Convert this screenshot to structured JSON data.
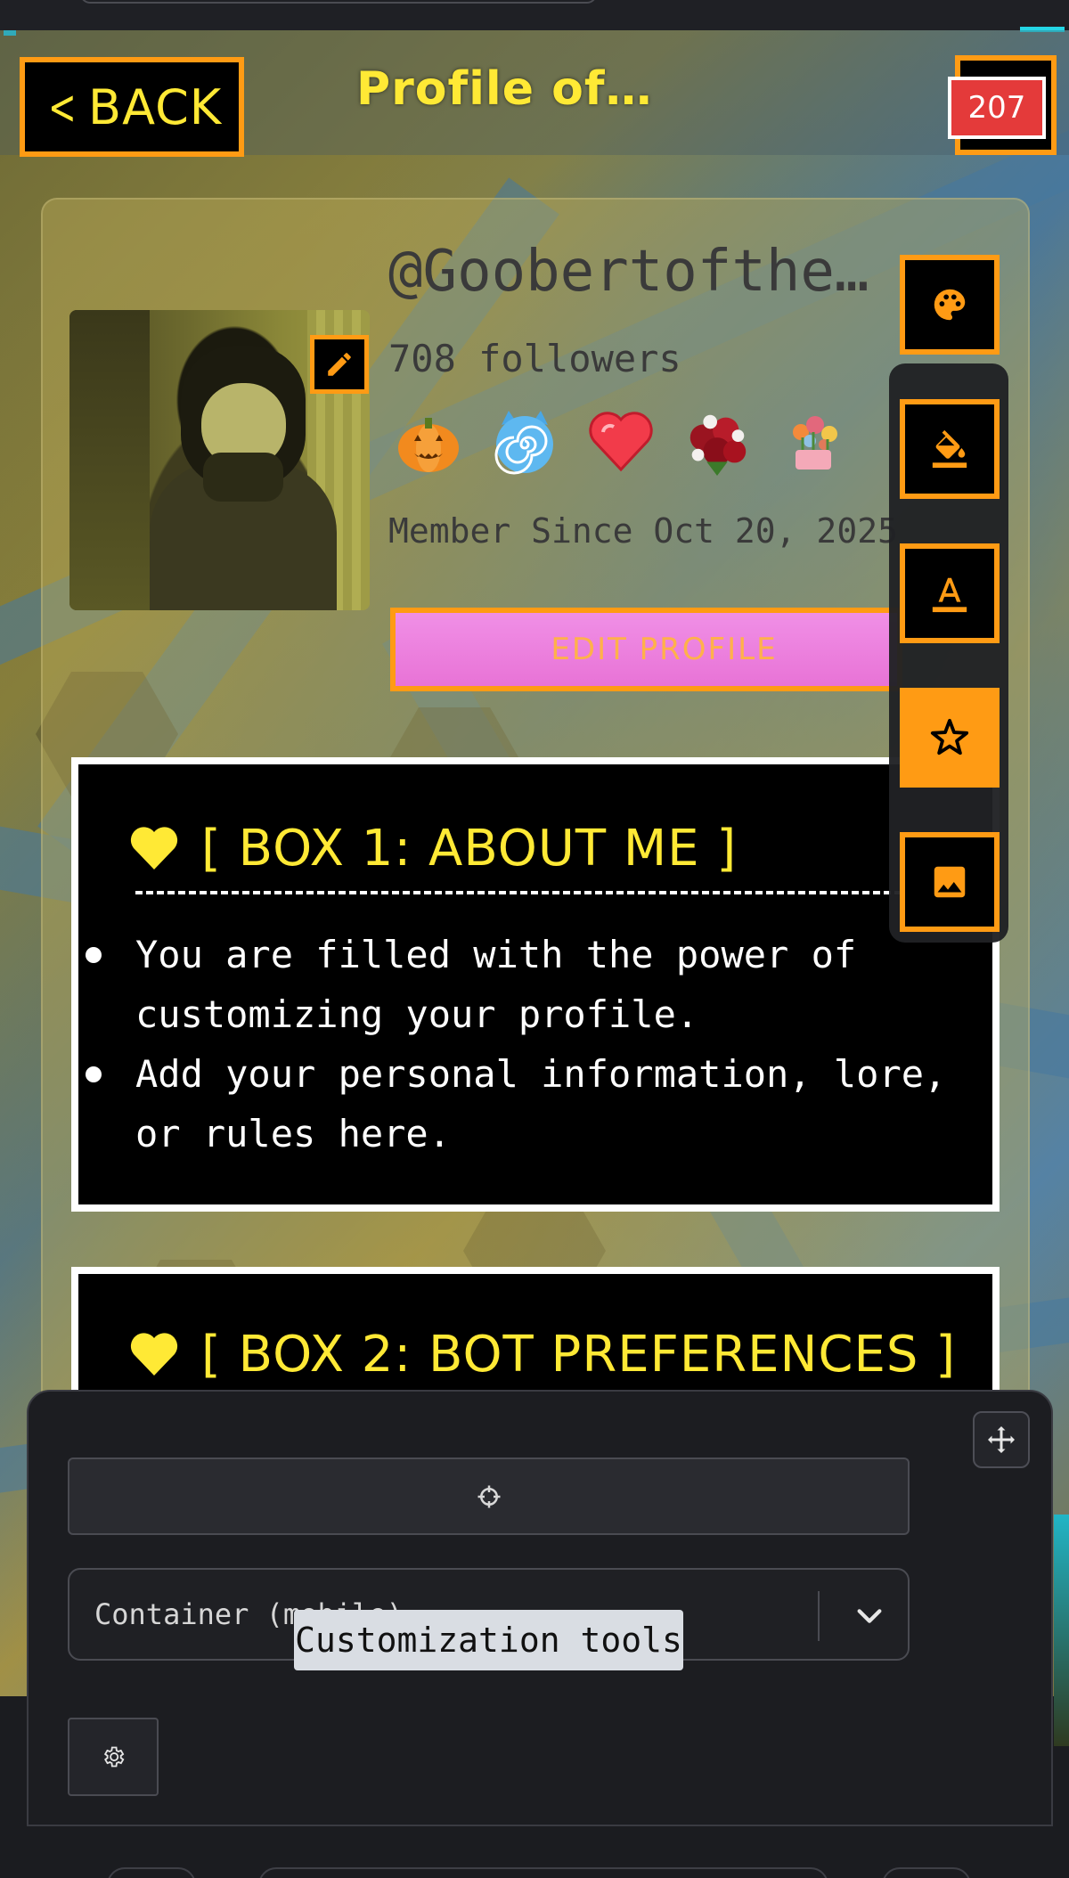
{
  "header": {
    "back_label": "BACK",
    "title": "Profile of…",
    "counter": "207"
  },
  "profile": {
    "username": "@Goobertofthe…",
    "followers": "708 followers",
    "member_since": "Member Since Oct 20, 2025",
    "edit_profile_label": "EDIT PROFILE",
    "badges": [
      "pumpkin-badge",
      "spiral-cat-badge",
      "heart-badge",
      "rose-bouquet-badge",
      "flower-pot-badge"
    ]
  },
  "tools": [
    {
      "icon": "palette-icon",
      "active": false
    },
    {
      "icon": "paint-bucket-icon",
      "active": false
    },
    {
      "icon": "text-color-icon",
      "active": false
    },
    {
      "icon": "sparkle-icon",
      "active": true
    },
    {
      "icon": "image-icon",
      "active": false
    }
  ],
  "boxes": [
    {
      "title": "[ BOX 1: ABOUT ME ]",
      "items": [
        "You are filled with the power of customizing your profile.",
        "Add your personal information, lore, or rules here."
      ]
    },
    {
      "title": "[ BOX 2: BOT PREFERENCES ]"
    }
  ],
  "panel": {
    "select_value": "Container (mobile)",
    "tooltip": "Customization tools"
  },
  "colors": {
    "accent": "#ff9b14",
    "title_yellow": "#ffe935",
    "edit_pink": "#ec7fde",
    "counter_red": "#e43a3a"
  }
}
